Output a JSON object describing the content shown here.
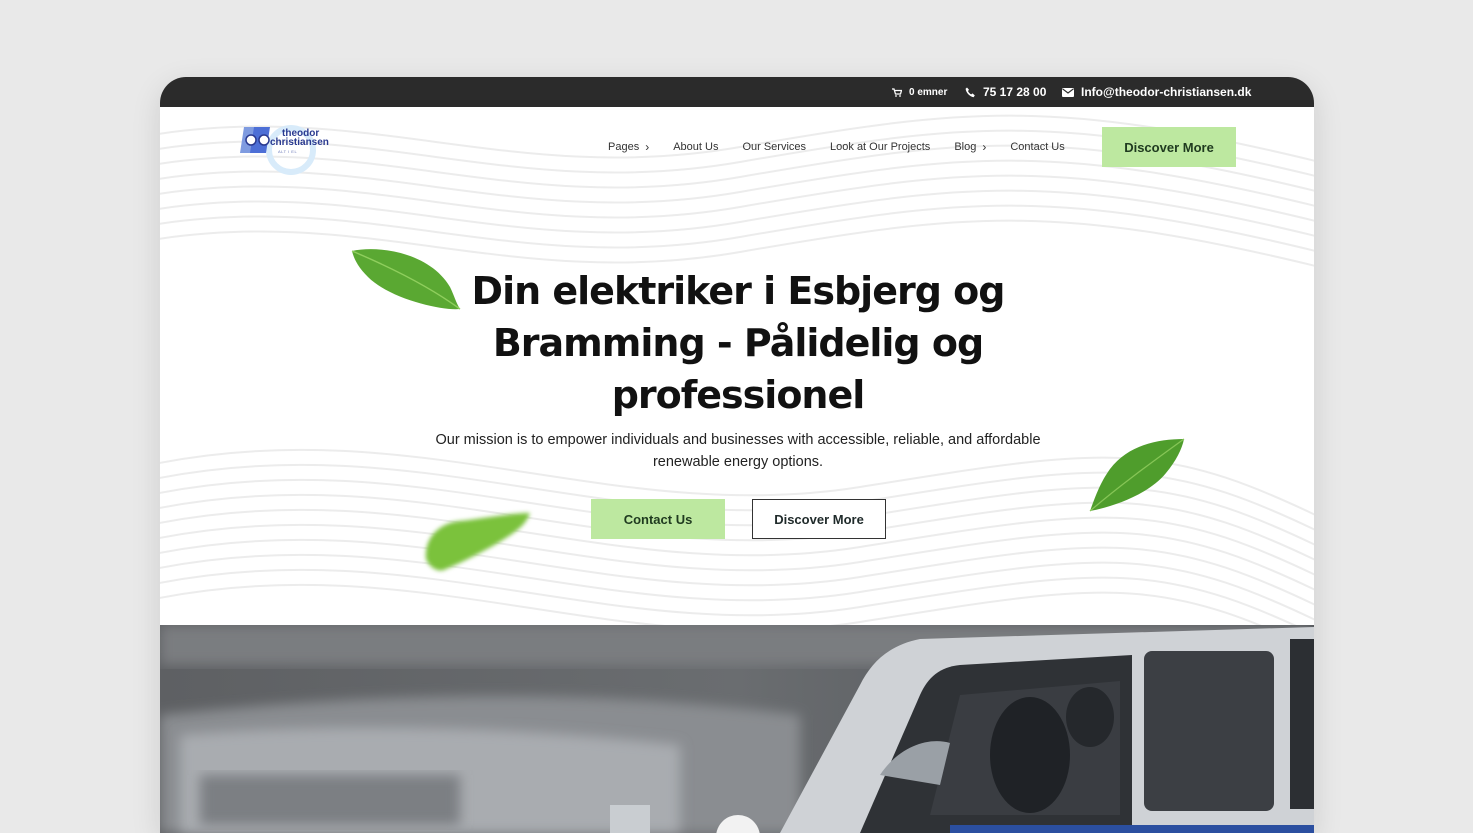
{
  "topbar": {
    "cart_label": "0 emner",
    "phone": "75 17 28 00",
    "email": "Info@theodor-christiansen.dk"
  },
  "logo": {
    "line1": "theodor",
    "line2": "christiansen",
    "tagline": "ALT I EL"
  },
  "nav": {
    "items": [
      {
        "label": "Pages",
        "has_dropdown": true
      },
      {
        "label": "About Us",
        "has_dropdown": false
      },
      {
        "label": "Our Services",
        "has_dropdown": false
      },
      {
        "label": "Look at Our Projects",
        "has_dropdown": false
      },
      {
        "label": "Blog",
        "has_dropdown": true
      },
      {
        "label": "Contact Us",
        "has_dropdown": false
      }
    ],
    "cta_label": "Discover More"
  },
  "hero": {
    "title_line1": "Din elektriker i Esbjerg og",
    "title_line2": "Bramming - Pålidelig og",
    "title_line3": "professionel",
    "subtitle_line1": "Our mission is to empower individuals and businesses with accessible, reliable, and affordable",
    "subtitle_line2": "renewable energy options.",
    "primary_button": "Contact Us",
    "secondary_button": "Discover More"
  },
  "colors": {
    "accent_green": "#bde8a0",
    "topbar_bg": "#2b2b2b",
    "logo_blue": "#2a3a90"
  },
  "icons": {
    "cart": "cart-icon",
    "phone": "phone-icon",
    "email": "envelope-icon",
    "chevron": "chevron-right-icon"
  }
}
